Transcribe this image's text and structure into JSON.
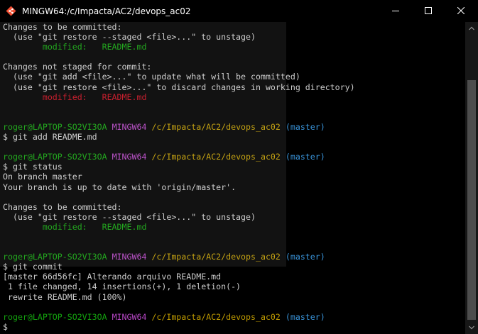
{
  "window": {
    "title": "MINGW64:/c/Impacta/AC2/devops_ac02",
    "app_icon": "git-bash-icon"
  },
  "window_controls": {
    "minimize_icon": "minimize-icon",
    "maximize_icon": "maximize-icon",
    "close_icon": "close-icon"
  },
  "colors": {
    "background": "#000000",
    "default_text": "#cccccc",
    "green": "#13a10e",
    "red": "#c50f1f",
    "magenta": "#b847c7",
    "yellow": "#c19c00",
    "cyan": "#3a96dd",
    "scrollbar_thumb": "#4d4d4d"
  },
  "terminal": {
    "lines": [
      [
        {
          "text": "Changes to be committed:",
          "color": "default"
        }
      ],
      [
        {
          "text": "  (use \"git restore --staged <file>...\" to unstage)",
          "color": "default"
        }
      ],
      [
        {
          "text": "        modified:   README.md",
          "color": "green"
        }
      ],
      [
        {
          "text": "",
          "color": "default"
        }
      ],
      [
        {
          "text": "Changes not staged for commit:",
          "color": "default"
        }
      ],
      [
        {
          "text": "  (use \"git add <file>...\" to update what will be committed)",
          "color": "default"
        }
      ],
      [
        {
          "text": "  (use \"git restore <file>...\" to discard changes in working directory)",
          "color": "default"
        }
      ],
      [
        {
          "text": "        modified:   README.md",
          "color": "red"
        }
      ],
      [
        {
          "text": "",
          "color": "default"
        }
      ],
      [
        {
          "text": "",
          "color": "default"
        }
      ],
      [
        {
          "text": "roger@LAPTOP-SO2VI3OA ",
          "color": "green"
        },
        {
          "text": "MINGW64 ",
          "color": "magenta"
        },
        {
          "text": "/c/Impacta/AC2/devops_ac02 ",
          "color": "yellow"
        },
        {
          "text": "(master)",
          "color": "cyan"
        }
      ],
      [
        {
          "text": "$ git add README.md",
          "color": "default"
        }
      ],
      [
        {
          "text": "",
          "color": "default"
        }
      ],
      [
        {
          "text": "roger@LAPTOP-SO2VI3OA ",
          "color": "green"
        },
        {
          "text": "MINGW64 ",
          "color": "magenta"
        },
        {
          "text": "/c/Impacta/AC2/devops_ac02 ",
          "color": "yellow"
        },
        {
          "text": "(master)",
          "color": "cyan"
        }
      ],
      [
        {
          "text": "$ git status",
          "color": "default"
        }
      ],
      [
        {
          "text": "On branch master",
          "color": "default"
        }
      ],
      [
        {
          "text": "Your branch is up to date with 'origin/master'.",
          "color": "default"
        }
      ],
      [
        {
          "text": "",
          "color": "default"
        }
      ],
      [
        {
          "text": "Changes to be committed:",
          "color": "default"
        }
      ],
      [
        {
          "text": "  (use \"git restore --staged <file>...\" to unstage)",
          "color": "default"
        }
      ],
      [
        {
          "text": "        modified:   README.md",
          "color": "green"
        }
      ],
      [
        {
          "text": "",
          "color": "default"
        }
      ],
      [
        {
          "text": "",
          "color": "default"
        }
      ],
      [
        {
          "text": "roger@LAPTOP-SO2VI3OA ",
          "color": "green"
        },
        {
          "text": "MINGW64 ",
          "color": "magenta"
        },
        {
          "text": "/c/Impacta/AC2/devops_ac02 ",
          "color": "yellow"
        },
        {
          "text": "(master)",
          "color": "cyan"
        }
      ],
      [
        {
          "text": "$ git commit",
          "color": "default"
        }
      ],
      [
        {
          "text": "[master 66d56fc] Alterando arquivo README.md",
          "color": "default"
        }
      ],
      [
        {
          "text": " 1 file changed, 14 insertions(+), 1 deletion(-)",
          "color": "default"
        }
      ],
      [
        {
          "text": " rewrite README.md (100%)",
          "color": "default"
        }
      ],
      [
        {
          "text": "",
          "color": "default"
        }
      ],
      [
        {
          "text": "roger@LAPTOP-SO2VI3OA ",
          "color": "green"
        },
        {
          "text": "MINGW64 ",
          "color": "magenta"
        },
        {
          "text": "/c/Impacta/AC2/devops_ac02 ",
          "color": "yellow"
        },
        {
          "text": "(master)",
          "color": "cyan"
        }
      ],
      [
        {
          "text": "$",
          "color": "default"
        }
      ]
    ]
  },
  "scrollbar": {
    "up_icon": "chevron-up-icon",
    "down_icon": "chevron-down-icon"
  }
}
